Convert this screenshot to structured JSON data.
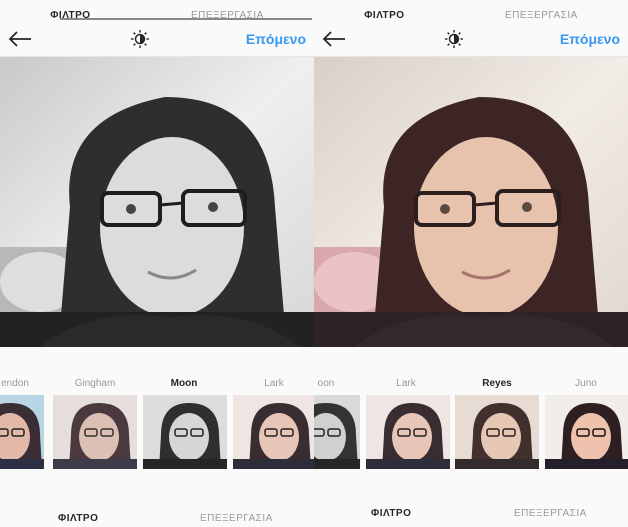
{
  "left": {
    "prev_tabs": [
      "ΦΙΛΤΡΟ",
      "ΕΠΕΞΕΡΓΑΣΙΑ"
    ],
    "next_label": "Επόμενο",
    "filters": [
      {
        "label": "endon",
        "selected": false
      },
      {
        "label": "Gingham",
        "selected": false
      },
      {
        "label": "Moon",
        "selected": true
      },
      {
        "label": "Lark",
        "selected": false
      }
    ],
    "tabs": {
      "filter": "ΦΙΛΤΡΟ",
      "edit": "ΕΠΕΞΕΡΓΑΣΙΑ"
    }
  },
  "right": {
    "prev_tabs": [
      "ΦΙΛΤΡΟ",
      "ΕΠΕΞΕΡΓΑΣΙΑ"
    ],
    "next_label": "Επόμενο",
    "filters": [
      {
        "label": "oon",
        "selected": false
      },
      {
        "label": "Lark",
        "selected": false
      },
      {
        "label": "Reyes",
        "selected": true
      },
      {
        "label": "Juno",
        "selected": false
      }
    ],
    "tabs": {
      "filter": "ΦΙΛΤΡΟ",
      "edit": "ΕΠΕΞΕΡΓΑΣΙΑ"
    }
  },
  "icons": {
    "back": "arrow-left-icon",
    "lux": "sun-icon"
  },
  "colors": {
    "accent": "#3897f0",
    "text": "#262626",
    "muted": "#999999"
  }
}
